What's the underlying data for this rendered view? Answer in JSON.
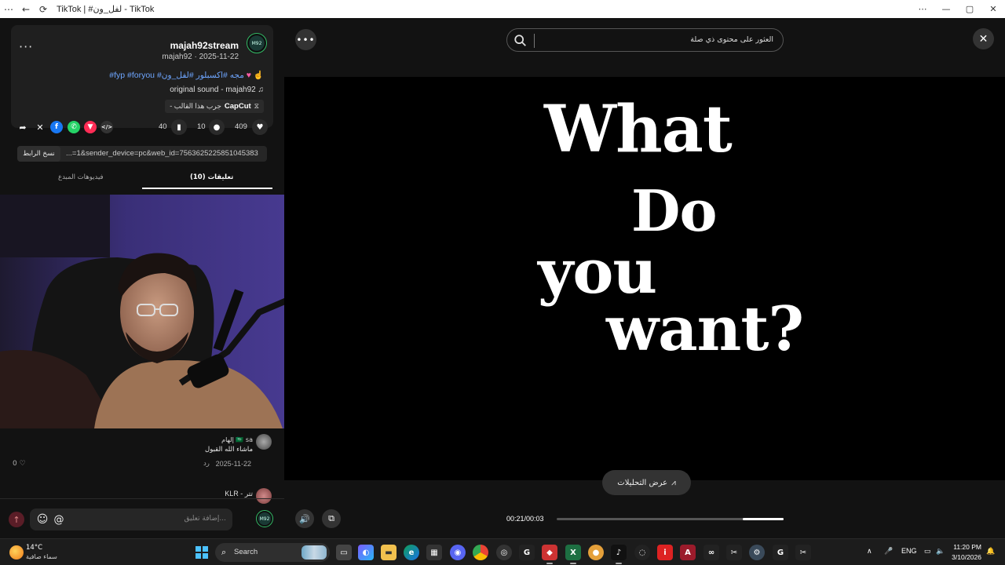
{
  "titlebar": {
    "back": "←",
    "refresh": "⟳",
    "title": "TikTok | #لفل_ون - TikTok",
    "minimize": "—",
    "restore": "▢",
    "close": "✕",
    "menu": "⋯"
  },
  "post": {
    "username": "majah92stream",
    "meta": "majah92 · 2025-11-22",
    "avatar_text": "M92",
    "caption_hashtags": "#fyp #foryou #مجه #اكسبلور #لفل_ون",
    "music": "original sound - majah92",
    "capcut_brand": "CapCut",
    "capcut_text": "- جرب هذا القالب",
    "more": "···"
  },
  "stats": {
    "likes": "409",
    "comments": "10",
    "saves": "40"
  },
  "share": {
    "link": "...=1&sender_device=pc&web_id=7563625225851045383",
    "copy_label": "نسخ الرابط"
  },
  "tabs": {
    "comments": "تعليقات (10)",
    "creator_videos": "فيديوهات المبدع"
  },
  "comments": [
    {
      "name": "إلهام 🇸🇦 sa",
      "text": "ماشاء الله القبول",
      "date": "2025-11-22",
      "reply": "رد",
      "likes": "0"
    },
    {
      "name": "KLR - تتر"
    }
  ],
  "comment_input": {
    "placeholder": "إضافة تعليق...",
    "mention": "@",
    "emoji": "☺",
    "send": "↑"
  },
  "player": {
    "search_placeholder": "العثور على محتوى ذي صلة",
    "video_lines": [
      "What",
      "Do",
      "you",
      "want?"
    ],
    "analytics_label": "عرض التحليلات",
    "time": "00:21/00:03",
    "progress": 0.18,
    "more": "•••",
    "close": "✕"
  },
  "taskbar": {
    "temp": "14°C",
    "weather": "سماء صافية",
    "search": "Search",
    "lang": "ENG",
    "time": "11:20 PM",
    "date": "3/10/2026"
  },
  "colors": {
    "accent_link": "#6ea6ff",
    "facebook": "#1877f2",
    "whatsapp": "#25d366",
    "tiktok_red": "#fe2c55",
    "win_blue": "#4cc2ff"
  }
}
